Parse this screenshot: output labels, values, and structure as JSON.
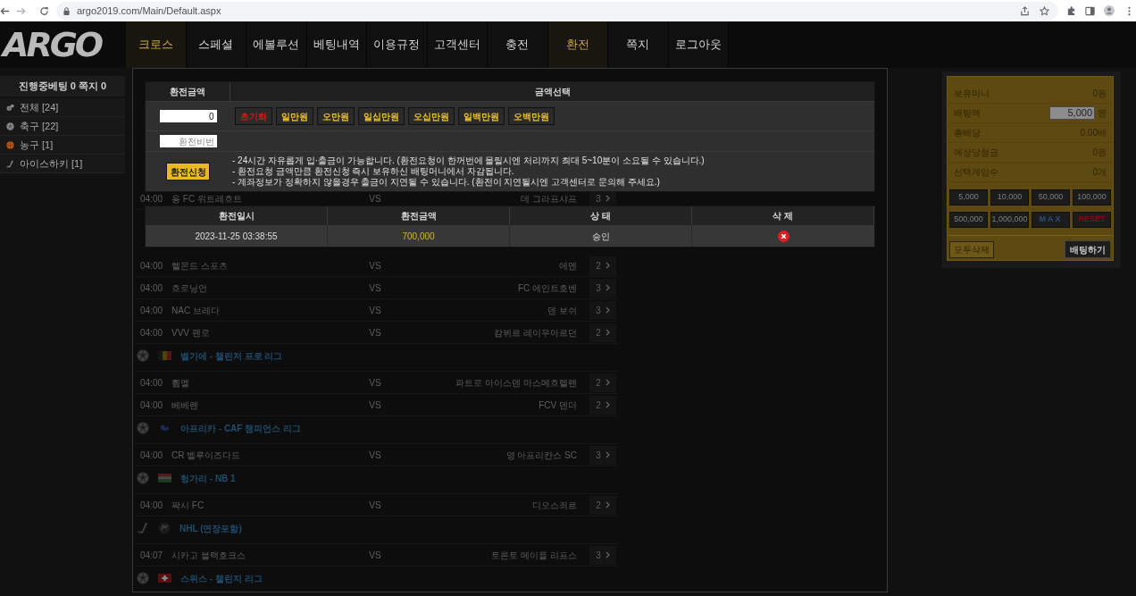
{
  "browser": {
    "url": "argo2019.com/Main/Default.aspx"
  },
  "nav": {
    "logo": "ARGO",
    "items": [
      {
        "label": "크로스",
        "selected": true
      },
      {
        "label": "스페셜",
        "selected": false
      },
      {
        "label": "에볼루션",
        "selected": false
      },
      {
        "label": "베팅내역",
        "selected": false
      },
      {
        "label": "이용규정",
        "selected": false
      },
      {
        "label": "고객센터",
        "selected": false
      },
      {
        "label": "충전",
        "selected": false
      },
      {
        "label": "환전",
        "selected": true
      },
      {
        "label": "쪽지",
        "selected": false
      },
      {
        "label": "로그아웃",
        "selected": false
      }
    ]
  },
  "sidebar": {
    "header": "진행중베팅 0 쪽지 0",
    "items": [
      {
        "label": "전체 [24]",
        "kind": "all"
      },
      {
        "label": "축구 [22]",
        "kind": "soccer"
      },
      {
        "label": "농구 [1]",
        "kind": "basketball"
      },
      {
        "label": "아이스하키 [1]",
        "kind": "hockey"
      }
    ]
  },
  "games": {
    "between_panels": [
      {
        "kind": "match",
        "time": "04:00",
        "home": "용 FC 위트레흐트",
        "vs": "VS",
        "away": "데 그라프샤프",
        "count": "3"
      }
    ],
    "below_modal": [
      {
        "kind": "match",
        "time": "04:00",
        "home": "헬몬드 스포츠",
        "vs": "VS",
        "away": "에멘",
        "count": "2"
      },
      {
        "kind": "match",
        "time": "04:00",
        "home": "흐로닝언",
        "vs": "VS",
        "away": "FC 에인트호벤",
        "count": "3"
      },
      {
        "kind": "match",
        "time": "04:00",
        "home": "NAC 브레다",
        "vs": "VS",
        "away": "덴 보쉬",
        "count": "3"
      },
      {
        "kind": "match",
        "time": "04:00",
        "home": "VVV 펜로",
        "vs": "VS",
        "away": "캄뷔르 레이우아르던",
        "count": "2"
      },
      {
        "kind": "league",
        "sport": {
          "kind": "soccer"
        },
        "flag": {
          "kind": "belgium"
        },
        "name": "벨기에 - 챌린저 프로 리그"
      },
      {
        "kind": "match",
        "time": "04:00",
        "home": "륌멜",
        "vs": "VS",
        "away": "파트로 아이스덴 마스메흐렐렌",
        "count": "2"
      },
      {
        "kind": "match",
        "time": "04:00",
        "home": "베베렌",
        "vs": "VS",
        "away": "FCV 덴더",
        "count": "2"
      },
      {
        "kind": "league",
        "sport": {
          "kind": "soccer"
        },
        "flag": {
          "kind": "caf"
        },
        "name": "아프리카 - CAF 챔피언스 리그"
      },
      {
        "kind": "match",
        "time": "04:00",
        "home": "CR 벨루이즈다드",
        "vs": "VS",
        "away": "영 아프리칸스 SC",
        "count": "3"
      },
      {
        "kind": "league",
        "sport": {
          "kind": "soccer"
        },
        "flag": {
          "kind": "hungary"
        },
        "name": "헝가리 - NB 1"
      },
      {
        "kind": "match",
        "time": "04:00",
        "home": "팍시 FC",
        "vs": "VS",
        "away": "디오스죄르",
        "count": "2"
      },
      {
        "kind": "league",
        "sport": {
          "kind": "hockey"
        },
        "flag": {
          "kind": "nhl"
        },
        "name": "NHL (연장포함)"
      },
      {
        "kind": "match",
        "time": "04:07",
        "home": "시카고 블랙호크스",
        "vs": "VS",
        "away": "토론토 메이플 리프스",
        "count": "3"
      },
      {
        "kind": "league",
        "sport": {
          "kind": "soccer"
        },
        "flag": {
          "kind": "switzerland"
        },
        "name": "스위스 - 챌린지 리그"
      }
    ]
  },
  "exchange_modal": {
    "amount_label": "환전금액",
    "select_label": "금액선택",
    "amount_value": "0",
    "amount_buttons": [
      {
        "label": "초기화",
        "kind": "reset"
      },
      {
        "label": "일만원",
        "kind": "amount"
      },
      {
        "label": "오만원",
        "kind": "amount"
      },
      {
        "label": "일십만원",
        "kind": "amount"
      },
      {
        "label": "오십만원",
        "kind": "amount"
      },
      {
        "label": "일백만원",
        "kind": "amount"
      },
      {
        "label": "오백만원",
        "kind": "amount"
      }
    ],
    "password_placeholder": "환전비번",
    "submit": "환전신청",
    "notices": [
      "- 24시간 자유롭게 입·출금이 가능합니다. (환전요청이 한꺼번에 몰릴시엔 처리까지 최대 5~10분이 소요될 수 있습니다.)",
      "- 환전요청 금액만큼 환전신청 즉시 보유하신 배팅머니에서 자감됩니다.",
      "- 계좌정보가 정확하지 않을경우 출금이 지연될 수 있습니다. (환전이 지연될시엔 고객센터로 문의해 주세요.)"
    ],
    "history": {
      "columns": [
        "환전일시",
        "환전금액",
        "상 태",
        "삭 제"
      ],
      "rows": [
        {
          "datetime": "2023-11-25 03:38:55",
          "amount": "700,000",
          "status": "승인"
        }
      ]
    }
  },
  "bet_slip": {
    "rows": [
      {
        "label": "보유머니",
        "kind": "text",
        "value": "0원"
      },
      {
        "label": "배팅액",
        "kind": "input",
        "value": "5,000",
        "unit": "원"
      },
      {
        "label": "총배당",
        "kind": "text",
        "value": "0.00배"
      },
      {
        "label": "예상당첨금",
        "kind": "text",
        "value": "0원"
      },
      {
        "label": "선택게임수",
        "kind": "text",
        "value": "0개"
      }
    ],
    "quick_buttons": [
      {
        "label": "5,000",
        "kind": "amount"
      },
      {
        "label": "10,000",
        "kind": "amount"
      },
      {
        "label": "50,000",
        "kind": "amount"
      },
      {
        "label": "100,000",
        "kind": "amount"
      },
      {
        "label": "500,000",
        "kind": "amount"
      },
      {
        "label": "1,000,000",
        "kind": "amount"
      },
      {
        "label": "MAX",
        "kind": "max"
      },
      {
        "label": "RESET",
        "kind": "reset"
      }
    ],
    "clear_button": "모두삭제",
    "bet_button": "배팅하기"
  }
}
